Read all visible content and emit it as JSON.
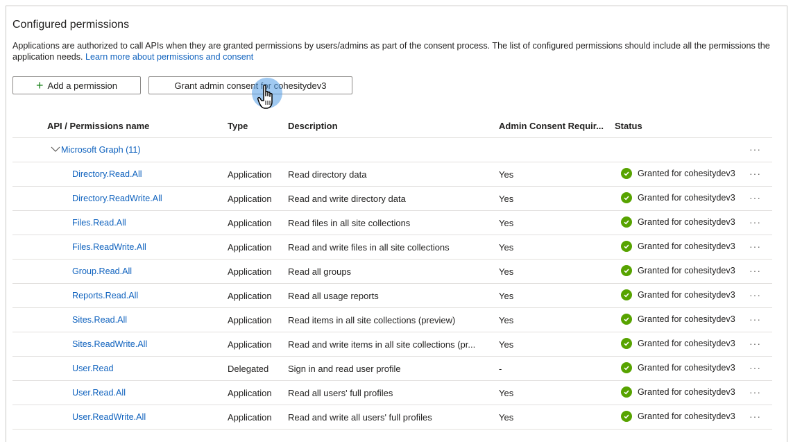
{
  "section": {
    "title": "Configured permissions",
    "description": "Applications are authorized to call APIs when they are granted permissions by users/admins as part of the consent process. The list of configured permissions should include all the permissions the application needs.",
    "learn_more_link": "Learn more about permissions and consent"
  },
  "toolbar": {
    "add_permission_label": "Add a permission",
    "grant_consent_label": "Grant admin consent for cohesitydev3"
  },
  "table": {
    "headers": {
      "name": "API / Permissions name",
      "type": "Type",
      "description": "Description",
      "admin_consent": "Admin Consent Requir...",
      "status": "Status"
    },
    "group": {
      "label": "Microsoft Graph (11)",
      "expanded": true
    },
    "more_actions": "···",
    "rows": [
      {
        "name": "Directory.Read.All",
        "type": "Application",
        "description": "Read directory data",
        "admin": "Yes",
        "status": "Granted for cohesitydev3"
      },
      {
        "name": "Directory.ReadWrite.All",
        "type": "Application",
        "description": "Read and write directory data",
        "admin": "Yes",
        "status": "Granted for cohesitydev3"
      },
      {
        "name": "Files.Read.All",
        "type": "Application",
        "description": "Read files in all site collections",
        "admin": "Yes",
        "status": "Granted for cohesitydev3"
      },
      {
        "name": "Files.ReadWrite.All",
        "type": "Application",
        "description": "Read and write files in all site collections",
        "admin": "Yes",
        "status": "Granted for cohesitydev3"
      },
      {
        "name": "Group.Read.All",
        "type": "Application",
        "description": "Read all groups",
        "admin": "Yes",
        "status": "Granted for cohesitydev3"
      },
      {
        "name": "Reports.Read.All",
        "type": "Application",
        "description": "Read all usage reports",
        "admin": "Yes",
        "status": "Granted for cohesitydev3"
      },
      {
        "name": "Sites.Read.All",
        "type": "Application",
        "description": "Read items in all site collections (preview)",
        "admin": "Yes",
        "status": "Granted for cohesitydev3"
      },
      {
        "name": "Sites.ReadWrite.All",
        "type": "Application",
        "description": "Read and write items in all site collections (pr...",
        "admin": "Yes",
        "status": "Granted for cohesitydev3"
      },
      {
        "name": "User.Read",
        "type": "Delegated",
        "description": "Sign in and read user profile",
        "admin": "-",
        "status": "Granted for cohesitydev3"
      },
      {
        "name": "User.Read.All",
        "type": "Application",
        "description": "Read all users' full profiles",
        "admin": "Yes",
        "status": "Granted for cohesitydev3"
      },
      {
        "name": "User.ReadWrite.All",
        "type": "Application",
        "description": "Read and write all users' full profiles",
        "admin": "Yes",
        "status": "Granted for cohesitydev3"
      }
    ]
  },
  "colors": {
    "link": "#0f62be",
    "granted_green": "#57a300",
    "add_plus_green": "#107c10",
    "border": "#e1dfdd"
  }
}
